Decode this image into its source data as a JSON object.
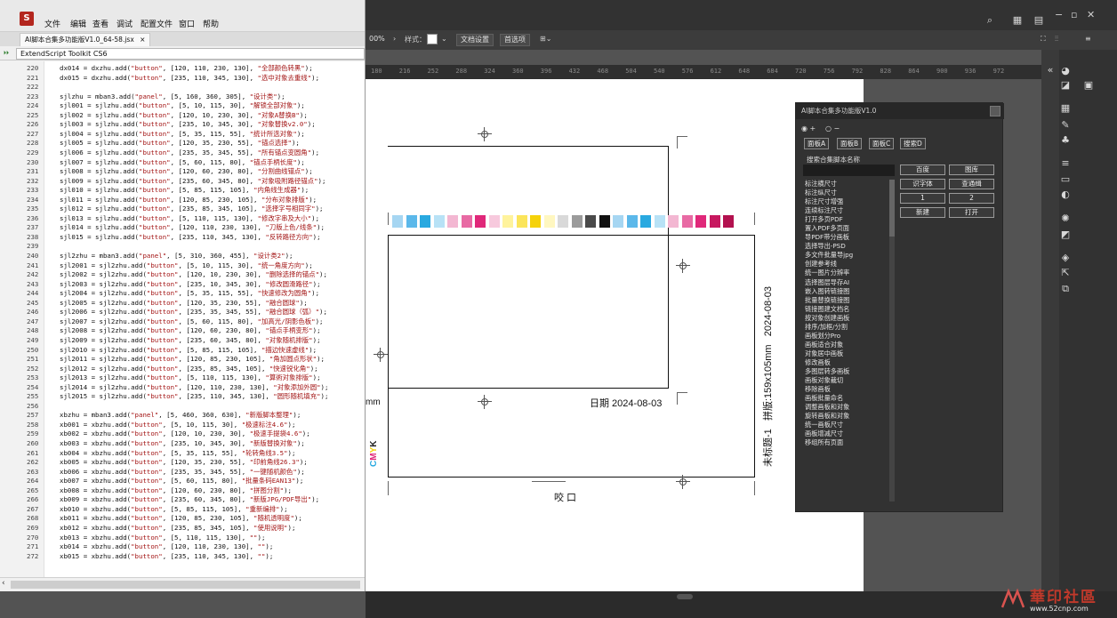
{
  "estk": {
    "app_name": "ExtendScript Toolkit CS6",
    "menu": [
      "文件",
      "编辑",
      "查看",
      "调试",
      "配置文件",
      "窗口",
      "帮助"
    ],
    "tab_title": "AI脚本合集多功能版V1.0_64-58.jsx",
    "tab_close": "×",
    "target_app": "ExtendScript Toolkit CS6",
    "lines": [
      {
        "n": "220",
        "code": "dx014 = dxzhu.add(\"button\", [120, 110, 230, 130], \"全部颜色转黑\");"
      },
      {
        "n": "221",
        "code": "dx015 = dxzhu.add(\"button\", [235, 110, 345, 130], \"选中对象去重线\");"
      },
      {
        "n": "222",
        "code": ""
      },
      {
        "n": "223",
        "code": "sjlzhu = mban3.add(\"panel\", [5, 160, 360, 305], \"设计类\");"
      },
      {
        "n": "224",
        "code": "sjl001 = sjlzhu.add(\"button\", [5, 10, 115, 30], \"解锁全部对象\");"
      },
      {
        "n": "225",
        "code": "sjl002 = sjlzhu.add(\"button\", [120, 10, 230, 30], \"对象A替换B\");"
      },
      {
        "n": "226",
        "code": "sjl003 = sjlzhu.add(\"button\", [235, 10, 345, 30], \"对象替换v2.0\");"
      },
      {
        "n": "227",
        "code": "sjl004 = sjlzhu.add(\"button\", [5, 35, 115, 55], \"统计所选对象\");"
      },
      {
        "n": "228",
        "code": "sjl005 = sjlzhu.add(\"button\", [120, 35, 230, 55], \"锚点选择\");"
      },
      {
        "n": "229",
        "code": "sjl006 = sjlzhu.add(\"button\", [235, 35, 345, 55], \"所有锚点变圆角\");"
      },
      {
        "n": "230",
        "code": "sjl007 = sjlzhu.add(\"button\", [5, 60, 115, 80], \"锚点手柄长度\");"
      },
      {
        "n": "231",
        "code": "sjl008 = sjlzhu.add(\"button\", [120, 60, 230, 80], \"分割曲线锚点\");"
      },
      {
        "n": "232",
        "code": "sjl009 = sjlzhu.add(\"button\", [235, 60, 345, 80], \"对象吸附路径锚点\");"
      },
      {
        "n": "233",
        "code": "sjl010 = sjlzhu.add(\"button\", [5, 85, 115, 105], \"内角线生成器\");"
      },
      {
        "n": "234",
        "code": "sjl011 = sjlzhu.add(\"button\", [120, 85, 230, 105], \"分布对象排版\");"
      },
      {
        "n": "235",
        "code": "sjl012 = sjlzhu.add(\"button\", [235, 85, 345, 105], \"选择字号相同字\");"
      },
      {
        "n": "236",
        "code": "sjl013 = sjlzhu.add(\"button\", [5, 110, 115, 130], \"修改字串及大小\");"
      },
      {
        "n": "237",
        "code": "sjl014 = sjlzhu.add(\"button\", [120, 110, 230, 130], \"刀版上色/线条\");"
      },
      {
        "n": "238",
        "code": "sjl015 = sjlzhu.add(\"button\", [235, 110, 345, 130], \"反转路径方向\");"
      },
      {
        "n": "239",
        "code": ""
      },
      {
        "n": "240",
        "code": "sjl2zhu = mban3.add(\"panel\", [5, 310, 360, 455], \"设计类2\");"
      },
      {
        "n": "241",
        "code": "sjl2001 = sjl2zhu.add(\"button\", [5, 10, 115, 30], \"统一角度方向\");"
      },
      {
        "n": "242",
        "code": "sjl2002 = sjl2zhu.add(\"button\", [120, 10, 230, 30], \"删除选择的锚点\");"
      },
      {
        "n": "243",
        "code": "sjl2003 = sjl2zhu.add(\"button\", [235, 10, 345, 30], \"修改圆滑路径\");"
      },
      {
        "n": "244",
        "code": "sjl2004 = sjl2zhu.add(\"button\", [5, 35, 115, 55], \"快速修改为圆角\");"
      },
      {
        "n": "245",
        "code": "sjl2005 = sjl2zhu.add(\"button\", [120, 35, 230, 55], \"融合圆球\");"
      },
      {
        "n": "246",
        "code": "sjl2006 = sjl2zhu.add(\"button\", [235, 35, 345, 55], \"融合圆球（弧）\");"
      },
      {
        "n": "247",
        "code": "sjl2007 = sjl2zhu.add(\"button\", [5, 60, 115, 80], \"加高光/阴影色板\");"
      },
      {
        "n": "248",
        "code": "sjl2008 = sjl2zhu.add(\"button\", [120, 60, 230, 80], \"锚点手柄变形\");"
      },
      {
        "n": "249",
        "code": "sjl2009 = sjl2zhu.add(\"button\", [235, 60, 345, 80], \"对象随机排版\");"
      },
      {
        "n": "250",
        "code": "sjl2010 = sjl2zhu.add(\"button\", [5, 85, 115, 105], \"描边快速虚线\");"
      },
      {
        "n": "251",
        "code": "sjl2011 = sjl2zhu.add(\"button\", [120, 85, 230, 105], \"角加圆点形状\");"
      },
      {
        "n": "252",
        "code": "sjl2012 = sjl2zhu.add(\"button\", [235, 85, 345, 105], \"快速锐化角\");"
      },
      {
        "n": "253",
        "code": "sjl2013 = sjl2zhu.add(\"button\", [5, 110, 115, 130], \"算術对象排版\");"
      },
      {
        "n": "254",
        "code": "sjl2014 = sjl2zhu.add(\"button\", [120, 110, 230, 130], \"对象添加外圆\");"
      },
      {
        "n": "255",
        "code": "sjl2015 = sjl2zhu.add(\"button\", [235, 110, 345, 130], \"圆形随机填充\");"
      },
      {
        "n": "256",
        "code": ""
      },
      {
        "n": "257",
        "code": "xbzhu = mban3.add(\"panel\", [5, 460, 360, 630], \"新版脚本整理\");"
      },
      {
        "n": "258",
        "code": "xb001 = xbzhu.add(\"button\", [5, 10, 115, 30], \"极速标注4.6\");"
      },
      {
        "n": "259",
        "code": "xb002 = xbzhu.add(\"button\", [120, 10, 230, 30], \"极速手提袋4.6\");"
      },
      {
        "n": "260",
        "code": "xb003 = xbzhu.add(\"button\", [235, 10, 345, 30], \"新版替换对象\");"
      },
      {
        "n": "261",
        "code": "xb004 = xbzhu.add(\"button\", [5, 35, 115, 55], \"轮转角线3.5\");"
      },
      {
        "n": "262",
        "code": "xb005 = xbzhu.add(\"button\", [120, 35, 230, 55], \"印前角线26.3\");"
      },
      {
        "n": "263",
        "code": "xb006 = xbzhu.add(\"button\", [235, 35, 345, 55], \"一键随机颜色\");"
      },
      {
        "n": "264",
        "code": "xb007 = xbzhu.add(\"button\", [5, 60, 115, 80], \"批量条码EAN13\");"
      },
      {
        "n": "265",
        "code": "xb008 = xbzhu.add(\"button\", [120, 60, 230, 80], \"拼图分割\");"
      },
      {
        "n": "266",
        "code": "xb009 = xbzhu.add(\"button\", [235, 60, 345, 80], \"新版JPG/PDF导出\");"
      },
      {
        "n": "267",
        "code": "xb010 = xbzhu.add(\"button\", [5, 85, 115, 105], \"重新编排\");"
      },
      {
        "n": "268",
        "code": "xb011 = xbzhu.add(\"button\", [120, 85, 230, 105], \"随机透明度\");"
      },
      {
        "n": "269",
        "code": "xb012 = xbzhu.add(\"button\", [235, 85, 345, 105], \"使用说明\");"
      },
      {
        "n": "270",
        "code": "xb013 = xbzhu.add(\"button\", [5, 110, 115, 130], \"\");"
      },
      {
        "n": "271",
        "code": "xb014 = xbzhu.add(\"button\", [120, 110, 230, 130], \"\");"
      },
      {
        "n": "272",
        "code": "xb015 = xbzhu.add(\"button\", [235, 110, 345, 130], \"\");"
      }
    ]
  },
  "illustrator": {
    "control": {
      "zoom": "00%",
      "style_label": "样式：",
      "doc_setup": "文档设置",
      "preferences": "首选项"
    },
    "ruler_ticks": [
      "180",
      "216",
      "252",
      "288",
      "324",
      "360",
      "396",
      "432",
      "468",
      "504",
      "540",
      "576",
      "612",
      "648",
      "684",
      "720",
      "756",
      "792",
      "828",
      "864",
      "900",
      "936",
      "972"
    ],
    "artwork": {
      "date_label": "日期 2024-08-03",
      "rotated_date": "2024-08-03",
      "size_label": "拼版:159x105mm",
      "title_label": "未标题-1",
      "mm_label": "mm",
      "cut_label": "咬 口",
      "cmyk": [
        "C",
        "M",
        "Y",
        "K"
      ],
      "cmyk_colors": [
        "#29a9e0",
        "#e0287a",
        "#f5d20a",
        "#222222"
      ],
      "swatches": [
        "#a6d6f2",
        "#5bb8ea",
        "#29a9e0",
        "#b8e2f6",
        "#f3b7d2",
        "#e86aa4",
        "#e0287a",
        "#f7c9dd",
        "#fff39c",
        "#fbe55a",
        "#f5d20a",
        "#fff7c0",
        "#d9d9d9",
        "#9b9b9b",
        "#4a4a4a",
        "#111111",
        "#a6d6f2",
        "#5bb8ea",
        "#29a9e0",
        "#b8e2f6",
        "#f3b7d2",
        "#e86aa4",
        "#e0287a",
        "#c7185f",
        "#b3114f"
      ]
    },
    "window_controls": [
      "−",
      "▫",
      "✕"
    ]
  },
  "panel": {
    "title": "AI脚本合集多功能版V1.0",
    "radio_plus": "+",
    "radio_minus": "−",
    "tabs": [
      "面板A",
      "面板B",
      "面板C",
      "搜索D"
    ],
    "search_label": "搜索合集脚本名称",
    "buttons": [
      "百度",
      "图库",
      "识字体",
      "查通缉",
      "1",
      "2",
      "新建",
      "打开"
    ],
    "list": [
      "标注横尺寸",
      "标注纵尺寸",
      "标注尺寸增强",
      "连续标注尺寸",
      "打开多页PDF",
      "置入PDF多页面",
      "导PDF带分画板",
      "选择导出-PSD",
      "多文件批量导jpg",
      "创建参考线",
      "统一图片分辨率",
      "选择图层导存AI",
      "嵌入图转链接图",
      "批量替换链接图",
      "链接图建文档名",
      "按对象创建画板",
      "排序/加框/分割",
      "画板划分Pro",
      "画板适合对象",
      "对象居中画板",
      "修改画板",
      "多图层转多画板",
      "画板对象裁切",
      "移除画板",
      "画板批量命名",
      "调整画板和对象",
      "旋转画板和对象",
      "统一画板尺寸",
      "画板增减尺寸",
      "移组所有页面"
    ]
  },
  "watermark": {
    "text": "華印社區",
    "url": "www.52cnp.com"
  }
}
